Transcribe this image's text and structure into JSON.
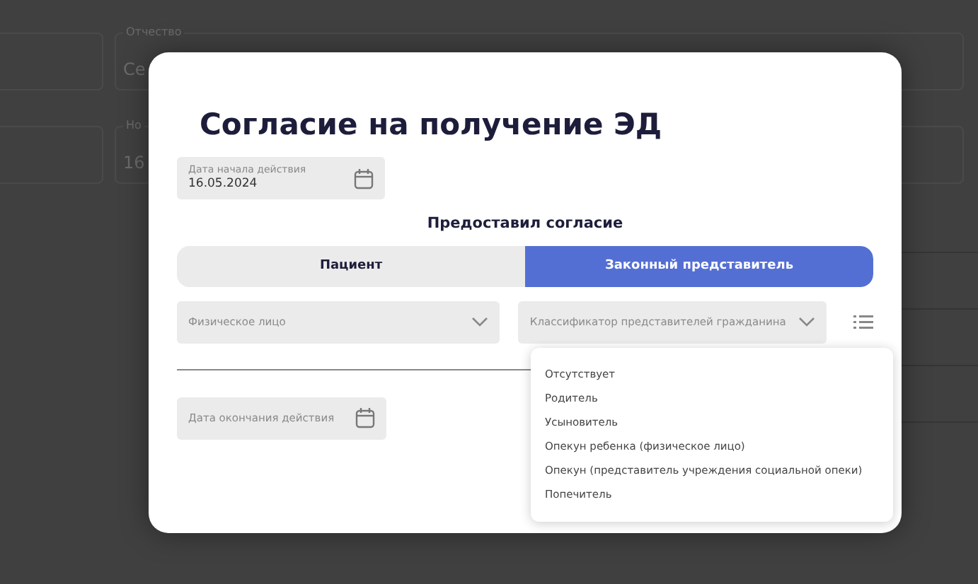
{
  "background_form": {
    "fields": [
      {
        "label": "Отчество",
        "value": "Се"
      },
      {
        "label": "Но",
        "value": "16"
      }
    ]
  },
  "modal": {
    "title": "Согласие на получение ЭД",
    "start_date": {
      "label": "Дата начала действия",
      "value": "16.05.2024"
    },
    "consent_heading": "Предоставил согласие",
    "consent_tabs": [
      {
        "label": "Пациент",
        "selected": false
      },
      {
        "label": "Законный представитель",
        "selected": true
      }
    ],
    "person_type": {
      "placeholder": "Физическое лицо"
    },
    "representative_type": {
      "placeholder": "Классификатор представителей гражданина",
      "expanded": true,
      "options": [
        "Отсутствует",
        "Родитель",
        "Усыновитель",
        "Опекун ребенка (физическое лицо)",
        "Опекун (представитель учреждения социальной опеки)",
        "Попечитель"
      ]
    },
    "end_date": {
      "placeholder": "Дата окончания действия"
    }
  }
}
